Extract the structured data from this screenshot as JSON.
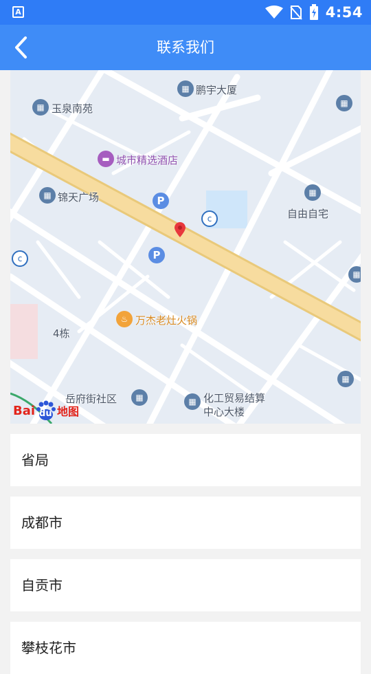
{
  "status_bar": {
    "left_icon": "A",
    "time": "4:54"
  },
  "header": {
    "title": "联系我们"
  },
  "map": {
    "labels": {
      "pengyu": "鹏宇大厦",
      "yuquan": "玉泉南苑",
      "chengshi": "城市精选酒店",
      "jintian": "锦天广场",
      "ziyou": "自由自宅",
      "wanjie": "万杰老灶火锅",
      "building4": "4栋",
      "yuefu": "岳府街社区",
      "huagong1": "化工贸易结算",
      "huagong2": "中心大楼"
    },
    "logo_bai": "Bai",
    "logo_du": "du",
    "logo_map": "地图"
  },
  "list": [
    {
      "label": "省局"
    },
    {
      "label": "成都市"
    },
    {
      "label": "自贡市"
    },
    {
      "label": "攀枝花市"
    }
  ],
  "colors": {
    "header_blue": "#3f8cf7",
    "status_blue": "#2f7cf6",
    "road_yellow": "#f5d99a",
    "pin_red": "#e8383d"
  }
}
